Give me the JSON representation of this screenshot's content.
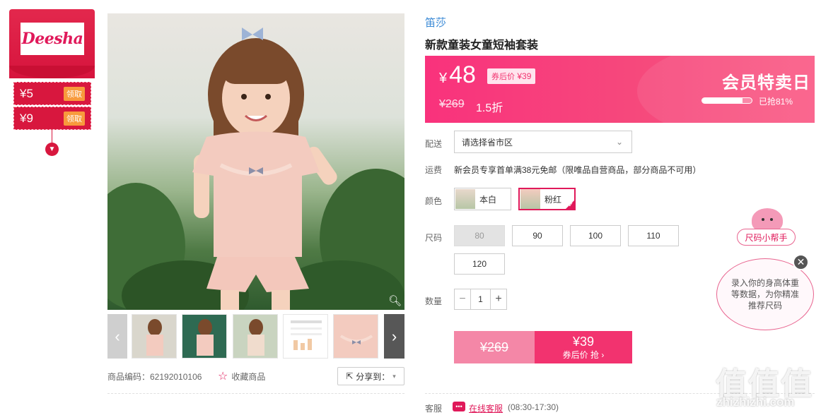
{
  "coupons": {
    "brand_logo": "Deesha",
    "items": [
      {
        "amount": "¥5",
        "action": "领取"
      },
      {
        "amount": "¥9",
        "action": "领取"
      }
    ],
    "expand_icon": "chevron-down-icon"
  },
  "gallery": {
    "zoom_icon": "magnifier-icon",
    "prev_icon": "chevron-left-icon",
    "next_icon": "chevron-right-icon",
    "thumbnails": 6,
    "sku_label": "商品编码：62192010106",
    "favorite_label": "收藏商品",
    "share_label": "分享到："
  },
  "product": {
    "brand": "笛莎",
    "title": "新款童装女童短袖套装"
  },
  "price": {
    "currency": "¥",
    "current": "48",
    "after_coupon_label": "券后价",
    "after_coupon_price": "¥39",
    "original": "¥269",
    "discount": "1.5折",
    "event_title": "会员特卖日",
    "sold_progress": 0.81,
    "sold_text": "已抢81%",
    "colors": {
      "banner_start": "#f9327c",
      "banner_end": "#fa5b86",
      "accent": "#e0195a"
    }
  },
  "delivery": {
    "label": "配送",
    "region_placeholder": "请选择省市区"
  },
  "shipping": {
    "label": "运费",
    "text": "新会员专享首单满38元免邮（限唯品自营商品，部分商品不可用）"
  },
  "color": {
    "label": "颜色",
    "options": [
      {
        "name": "本白",
        "selected": false
      },
      {
        "name": "粉红",
        "selected": true
      }
    ]
  },
  "size": {
    "label": "尺码",
    "options": [
      {
        "name": "80",
        "disabled": true
      },
      {
        "name": "90",
        "disabled": false
      },
      {
        "name": "100",
        "disabled": false
      },
      {
        "name": "110",
        "disabled": false
      },
      {
        "name": "120",
        "disabled": false
      }
    ]
  },
  "quantity": {
    "label": "数量",
    "value": "1",
    "minus": "−",
    "plus": "+"
  },
  "buy": {
    "original": "¥269",
    "price": "¥39",
    "sub_label": "券后价 抢 ›"
  },
  "service": {
    "label": "客服",
    "chat_link": "在线客服",
    "hours": "(08:30-17:30)"
  },
  "size_helper": {
    "title": "尺码小帮手",
    "bubble_text": "录入你的身高体重等数据，为你精准推荐尺码",
    "close": "✕"
  },
  "watermark": {
    "glyphs": "值值值",
    "text": "zhizhizhi.com"
  }
}
